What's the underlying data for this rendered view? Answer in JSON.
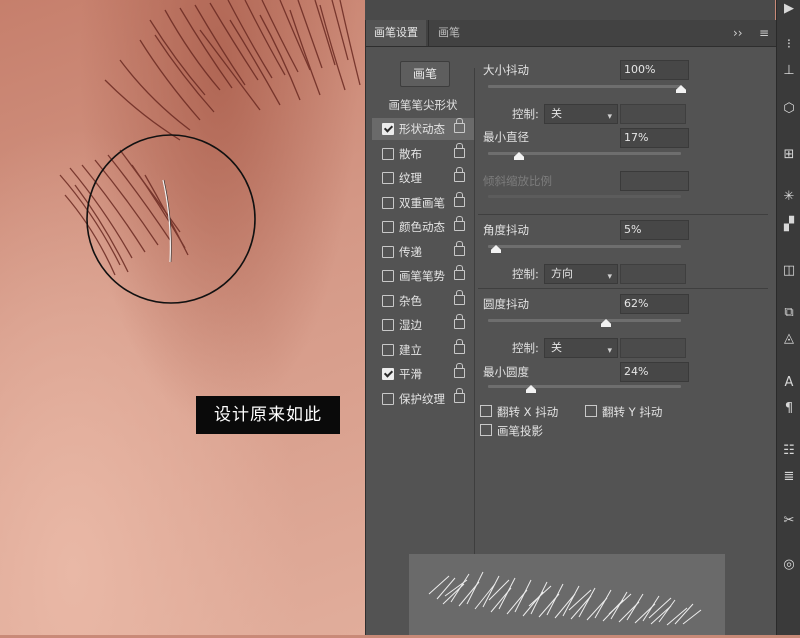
{
  "overlay": {
    "caption": "设计原来如此"
  },
  "panel": {
    "tabs": [
      "画笔设置",
      "画笔"
    ],
    "tab_controls": {
      "collapse": "››",
      "menu": "≡"
    },
    "brush_button": "画笔",
    "tip_shape_header": "画笔笔尖形状",
    "options": [
      {
        "label": "形状动态",
        "checked": true,
        "selected": true
      },
      {
        "label": "散布",
        "checked": false
      },
      {
        "label": "纹理",
        "checked": false
      },
      {
        "label": "双重画笔",
        "checked": false
      },
      {
        "label": "颜色动态",
        "checked": false
      },
      {
        "label": "传递",
        "checked": false
      },
      {
        "label": "画笔笔势",
        "checked": false
      },
      {
        "label": "杂色",
        "checked": false
      },
      {
        "label": "湿边",
        "checked": false
      },
      {
        "label": "建立",
        "checked": false
      },
      {
        "label": "平滑",
        "checked": true
      },
      {
        "label": "保护纹理",
        "checked": false
      }
    ],
    "settings": {
      "size_jitter": {
        "label": "大小抖动",
        "value": "100%",
        "slider": 1.0
      },
      "size_control": {
        "label": "控制:",
        "value": "关"
      },
      "min_diameter": {
        "label": "最小直径",
        "value": "17%",
        "slider": 0.17
      },
      "tilt_scale": {
        "label": "倾斜缩放比例"
      },
      "angle_jitter": {
        "label": "角度抖动",
        "value": "5%",
        "slider": 0.05
      },
      "angle_control": {
        "label": "控制:",
        "value": "方向"
      },
      "roundness_jitter": {
        "label": "圆度抖动",
        "value": "62%",
        "slider": 0.62
      },
      "roundness_control": {
        "label": "控制:",
        "value": "关"
      },
      "min_roundness": {
        "label": "最小圆度",
        "value": "24%",
        "slider": 0.24
      },
      "flip_x": {
        "label": "翻转 X 抖动",
        "checked": false
      },
      "flip_y": {
        "label": "翻转 Y 抖动",
        "checked": false
      },
      "brush_projection": {
        "label": "画笔投影",
        "checked": false
      }
    }
  },
  "colors": {
    "panel_bg": "#535353",
    "canvas_skin": "#d49886",
    "lash": "#6b2a22"
  }
}
